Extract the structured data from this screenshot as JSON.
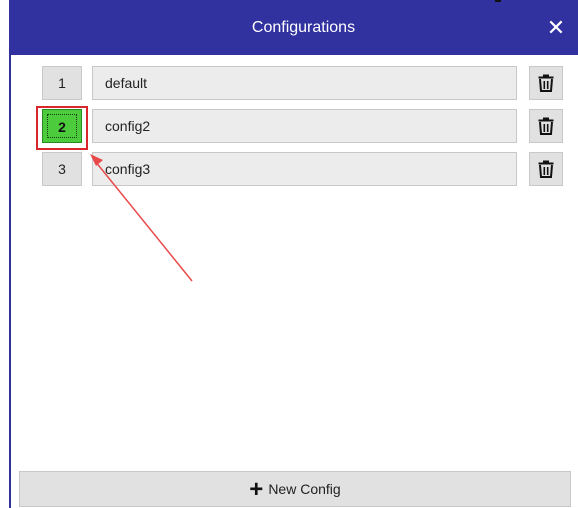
{
  "window": {
    "title": "Configurations",
    "close_glyph": "✕"
  },
  "configs": [
    {
      "index": "1",
      "name": "default",
      "active": false
    },
    {
      "index": "2",
      "name": "config2",
      "active": true
    },
    {
      "index": "3",
      "name": "config3",
      "active": false
    }
  ],
  "footer": {
    "new_config_label": "New Config",
    "new_config_icon": "plus-icon"
  },
  "icons": {
    "delete": "trash-icon",
    "close": "close-icon"
  },
  "colors": {
    "titlebar": "#3131a0",
    "active_index": "#4ccb3c",
    "annotation": "#d9262a"
  }
}
